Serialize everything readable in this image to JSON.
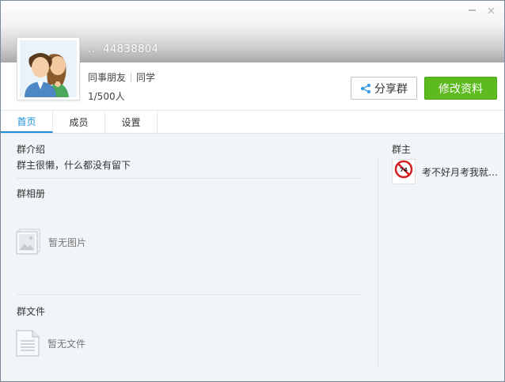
{
  "group": {
    "name_prefix": "..",
    "name": "44838804",
    "tags": [
      "同事朋友",
      "同学"
    ],
    "member_count": "1/500人"
  },
  "actions": {
    "share_label": "分享群",
    "edit_label": "修改资料"
  },
  "tabs": [
    {
      "label": "首页",
      "active": true
    },
    {
      "label": "成员",
      "active": false
    },
    {
      "label": "设置",
      "active": false
    }
  ],
  "intro": {
    "title": "群介绍",
    "text": "群主很懒，什么都没有留下"
  },
  "album": {
    "title": "群相册",
    "empty_text": "暂无图片"
  },
  "files": {
    "title": "群文件",
    "empty_text": "暂无文件"
  },
  "owner": {
    "title": "群主",
    "name": "考不好月考我就…",
    "avatar_text": "不好月考就不转"
  },
  "colors": {
    "accent": "#1a8fd8",
    "edit_button": "#5dba1f"
  }
}
